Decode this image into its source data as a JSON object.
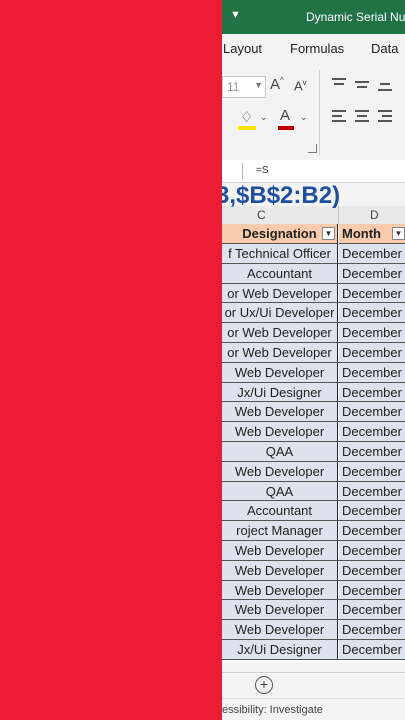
{
  "window": {
    "title": "Dynamic Serial Nu"
  },
  "ribbon": {
    "tabs": [
      "Layout",
      "Formulas",
      "Data"
    ],
    "font_size": "11",
    "grow_font_glyph": "A",
    "shrink_font_glyph": "A",
    "font_color_glyph": "A",
    "accent_fill": "#ffe600",
    "accent_font": "#c00000"
  },
  "formula_bar": {
    "text": "=S"
  },
  "overlay_formula": "3,$B$2:B2)",
  "columns": {
    "c": "C",
    "d": "D"
  },
  "table": {
    "headers": {
      "designation": "Designation",
      "month": "Month"
    },
    "rows": [
      {
        "designation": "f Technical Officer",
        "month": "December"
      },
      {
        "designation": "Accountant",
        "month": "December"
      },
      {
        "designation": "or Web Developer",
        "month": "December"
      },
      {
        "designation": "or Ux/Ui Developer",
        "month": "December"
      },
      {
        "designation": "or Web Developer",
        "month": "December"
      },
      {
        "designation": "or Web Developer",
        "month": "December"
      },
      {
        "designation": "Web Developer",
        "month": "December"
      },
      {
        "designation": "Jx/Ui Designer",
        "month": "December"
      },
      {
        "designation": "Web Developer",
        "month": "December"
      },
      {
        "designation": "Web Developer",
        "month": "December"
      },
      {
        "designation": "QAA",
        "month": "December"
      },
      {
        "designation": "Web Developer",
        "month": "December"
      },
      {
        "designation": "QAA",
        "month": "December"
      },
      {
        "designation": "Accountant",
        "month": "December"
      },
      {
        "designation": "roject Manager",
        "month": "December"
      },
      {
        "designation": "Web Developer",
        "month": "December"
      },
      {
        "designation": "Web Developer",
        "month": "December"
      },
      {
        "designation": "Web Developer",
        "month": "December"
      },
      {
        "designation": "Web Developer",
        "month": "December"
      },
      {
        "designation": "Web Developer",
        "month": "December"
      },
      {
        "designation": "Jx/Ui Designer",
        "month": "December"
      }
    ]
  },
  "sheet_tabs": {
    "add_label": "+"
  },
  "status_bar": {
    "text": "essibility: Investigate"
  },
  "colors": {
    "excel_green": "#217346",
    "header_fill": "#f8cbad",
    "row_fill": "#dce3ec",
    "left_panel": "#ec1c34"
  }
}
